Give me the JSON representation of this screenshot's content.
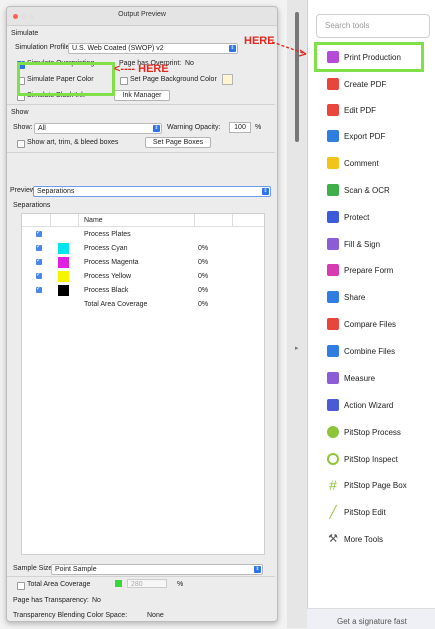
{
  "dialog": {
    "title": "Output Preview",
    "simulate_header": "Simulate",
    "sim_profile_label": "Simulation Profile:",
    "sim_profile_value": "U.S. Web Coated (SWOP) v2",
    "simulate_overprinting": "Simulate Overprinting",
    "page_has_overprint": "Page has Overprint:",
    "page_has_overprint_value": "No",
    "simulate_paper_color": "Simulate Paper Color",
    "set_page_bg": "Set Page Background Color",
    "simulate_black_ink": "Simulate Black Ink",
    "ink_manager": "Ink Manager",
    "show_header": "Show",
    "show_label": "Show:",
    "show_value": "All",
    "warning_opacity": "Warning Opacity:",
    "warning_value": "100",
    "percent": "%",
    "show_boxes": "Show art, trim, & bleed boxes",
    "set_page_boxes": "Set Page Boxes",
    "preview_label": "Preview:",
    "preview_value": "Separations",
    "separations_header": "Separations",
    "table_name_col": "Name",
    "rows": [
      {
        "name": "Process Plates",
        "pct": ""
      },
      {
        "name": "Process Cyan",
        "pct": "0%"
      },
      {
        "name": "Process Magenta",
        "pct": "0%"
      },
      {
        "name": "Process Yellow",
        "pct": "0%"
      },
      {
        "name": "Process Black",
        "pct": "0%"
      },
      {
        "name": "Total Area Coverage",
        "pct": "0%"
      }
    ],
    "sample_size_label": "Sample Size:",
    "sample_size_value": "Point Sample",
    "total_area_coverage": "Total Area Coverage",
    "tac_value": "280",
    "page_has_transparency": "Page has Transparency:",
    "page_has_transparency_value": "No",
    "blend_space": "Transparency Blending Color Space:",
    "blend_space_value": "None"
  },
  "annotations": {
    "here_top": "HERE",
    "here_left": "<---- HERE"
  },
  "tools": {
    "search_placeholder": "Search tools",
    "items": [
      {
        "label": "Print Production",
        "icon": "print-production-icon",
        "color": "#b54ad8"
      },
      {
        "label": "Create PDF",
        "icon": "create-pdf-icon",
        "color": "#e8453c"
      },
      {
        "label": "Edit PDF",
        "icon": "edit-pdf-icon",
        "color": "#e8453c"
      },
      {
        "label": "Export PDF",
        "icon": "export-pdf-icon",
        "color": "#2f7de0"
      },
      {
        "label": "Comment",
        "icon": "comment-icon",
        "color": "#f0c419"
      },
      {
        "label": "Scan & OCR",
        "icon": "scan-ocr-icon",
        "color": "#3dae4a"
      },
      {
        "label": "Protect",
        "icon": "protect-icon",
        "color": "#3b5bdb"
      },
      {
        "label": "Fill & Sign",
        "icon": "fill-sign-icon",
        "color": "#8a5cd6"
      },
      {
        "label": "Prepare Form",
        "icon": "prepare-form-icon",
        "color": "#d63bb0"
      },
      {
        "label": "Share",
        "icon": "share-icon",
        "color": "#2f7de0"
      },
      {
        "label": "Compare Files",
        "icon": "compare-files-icon",
        "color": "#e8453c"
      },
      {
        "label": "Combine Files",
        "icon": "combine-files-icon",
        "color": "#2f7de0"
      },
      {
        "label": "Measure",
        "icon": "measure-icon",
        "color": "#8a5cd6"
      },
      {
        "label": "Action Wizard",
        "icon": "action-wizard-icon",
        "color": "#4b5bd6"
      },
      {
        "label": "PitStop Process",
        "icon": "pitstop-process-icon",
        "color": "#8fc43a"
      },
      {
        "label": "PitStop Inspect",
        "icon": "pitstop-inspect-icon",
        "color": "#8fc43a"
      },
      {
        "label": "PitStop Page Box",
        "icon": "pitstop-page-box-icon",
        "color": "#8fc43a"
      },
      {
        "label": "PitStop Edit",
        "icon": "pitstop-edit-icon",
        "color": "#8fc43a"
      },
      {
        "label": "More Tools",
        "icon": "more-tools-icon",
        "color": "#555555"
      }
    ],
    "footer": "Get a signature fast"
  },
  "colors": {
    "highlight": "#7fe04a",
    "annotation": "#e0281f",
    "cyan": "#00e5ee",
    "magenta": "#e020e0",
    "yellow": "#f5f500",
    "black": "#000000"
  }
}
